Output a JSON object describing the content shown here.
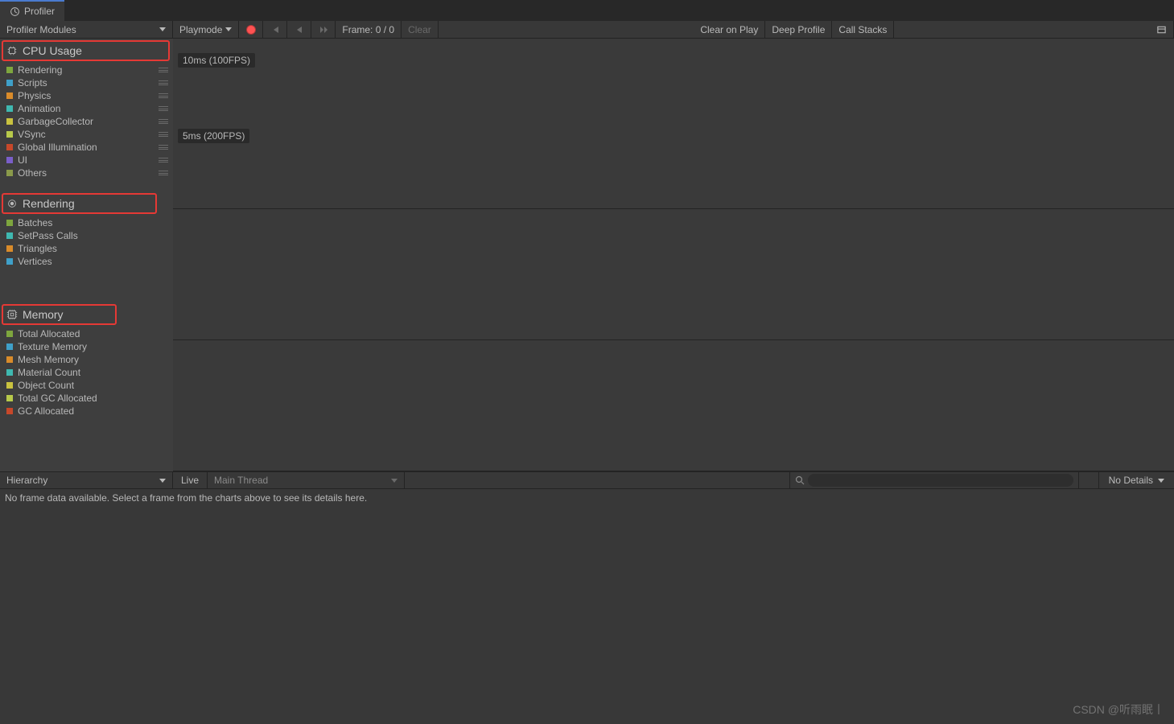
{
  "tab": {
    "title": "Profiler"
  },
  "toolbar": {
    "modules_label": "Profiler Modules",
    "playmode_label": "Playmode",
    "frame_label": "Frame: 0 / 0",
    "clear_label": "Clear",
    "clear_on_play": "Clear on Play",
    "deep_profile": "Deep Profile",
    "call_stacks": "Call Stacks"
  },
  "modules": {
    "cpu": {
      "title": "CPU Usage",
      "items": [
        {
          "label": "Rendering",
          "color": "#7ea63e"
        },
        {
          "label": "Scripts",
          "color": "#3fa0c9"
        },
        {
          "label": "Physics",
          "color": "#d98b2a"
        },
        {
          "label": "Animation",
          "color": "#3fb8b0"
        },
        {
          "label": "GarbageCollector",
          "color": "#c9c23f"
        },
        {
          "label": "VSync",
          "color": "#b7c94a"
        },
        {
          "label": "Global Illumination",
          "color": "#c7482a"
        },
        {
          "label": "UI",
          "color": "#7a5ec9"
        },
        {
          "label": "Others",
          "color": "#8a9a4a"
        }
      ],
      "fps_labels": [
        "10ms (100FPS)",
        "5ms (200FPS)"
      ]
    },
    "rendering": {
      "title": "Rendering",
      "items": [
        {
          "label": "Batches",
          "color": "#7ea63e"
        },
        {
          "label": "SetPass Calls",
          "color": "#3fb8b0"
        },
        {
          "label": "Triangles",
          "color": "#d98b2a"
        },
        {
          "label": "Vertices",
          "color": "#3fa0c9"
        }
      ]
    },
    "memory": {
      "title": "Memory",
      "items": [
        {
          "label": "Total Allocated",
          "color": "#7ea63e"
        },
        {
          "label": "Texture Memory",
          "color": "#3fa0c9"
        },
        {
          "label": "Mesh Memory",
          "color": "#d98b2a"
        },
        {
          "label": "Material Count",
          "color": "#3fb8b0"
        },
        {
          "label": "Object Count",
          "color": "#c9c23f"
        },
        {
          "label": "Total GC Allocated",
          "color": "#b7c94a"
        },
        {
          "label": "GC Allocated",
          "color": "#c7482a"
        }
      ]
    }
  },
  "details": {
    "mode": "Hierarchy",
    "live": "Live",
    "thread": "Main Thread",
    "no_details": "No Details",
    "empty_msg": "No frame data available. Select a frame from the charts above to see its details here."
  },
  "watermark": "CSDN @听雨眠丨"
}
